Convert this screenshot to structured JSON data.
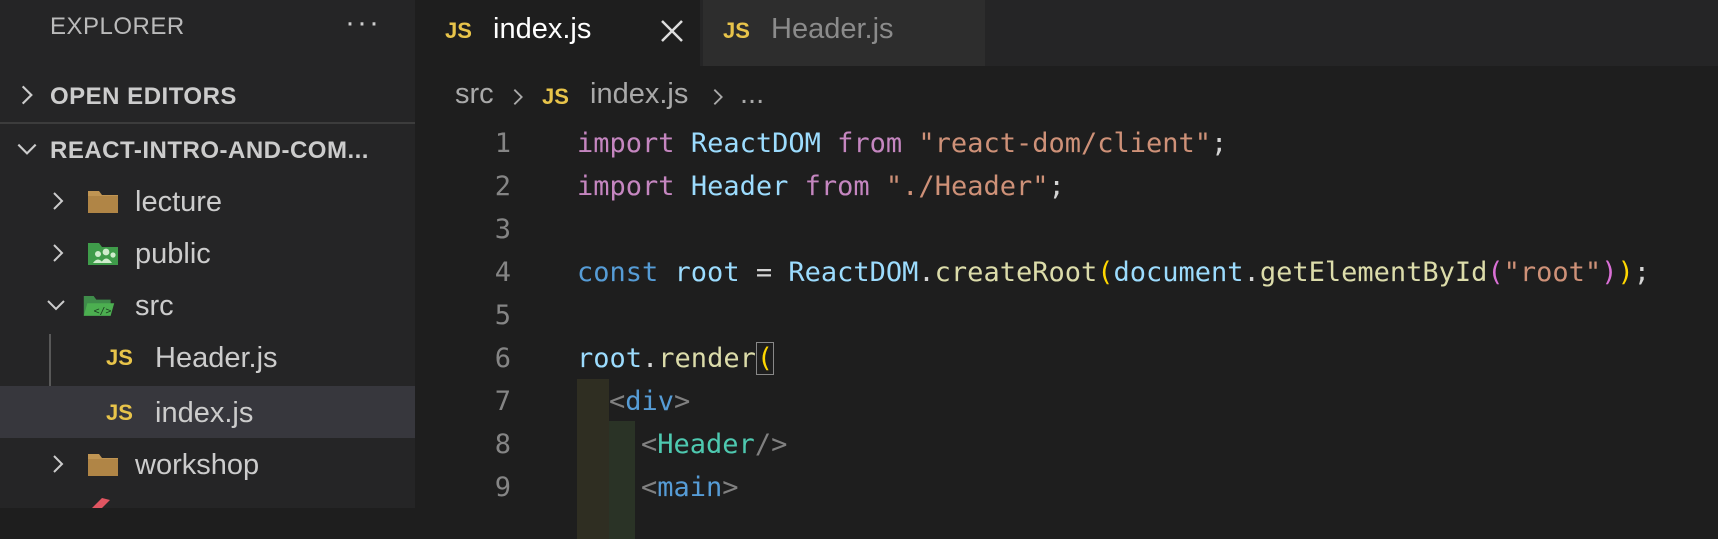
{
  "sidebar": {
    "title": "EXPLORER",
    "more_icon": "ellipsis-icon",
    "open_editors": "OPEN EDITORS",
    "project": "REACT-INTRO-AND-COM...",
    "items": [
      {
        "name": "lecture",
        "type": "folder"
      },
      {
        "name": "public",
        "type": "folder-public"
      },
      {
        "name": "src",
        "type": "folder-src"
      },
      {
        "name": "Header.js",
        "type": "js"
      },
      {
        "name": "index.js",
        "type": "js"
      },
      {
        "name": "workshop",
        "type": "folder"
      }
    ]
  },
  "tabs": [
    {
      "label": "index.js",
      "badge": "JS",
      "active": true
    },
    {
      "label": "Header.js",
      "badge": "JS",
      "active": false
    }
  ],
  "breadcrumb": {
    "folder": "src",
    "badge": "JS",
    "file": "index.js",
    "ellipsis": "..."
  },
  "editor": {
    "line_numbers": [
      "1",
      "2",
      "3",
      "4",
      "5",
      "6",
      "7",
      "8",
      "9"
    ],
    "l1": {
      "import": "import",
      "name": "ReactDOM",
      "from": "from",
      "path": "\"react-dom/client\"",
      "semi": ";"
    },
    "l2": {
      "import": "import",
      "name": "Header",
      "from": "from",
      "path": "\"./Header\"",
      "semi": ";"
    },
    "l4": {
      "const": "const",
      "root": "root",
      "eq": " = ",
      "obj": "ReactDOM",
      "dot": ".",
      "fn": "createRoot",
      "open": "(",
      "doc": "document",
      "dot2": ".",
      "fn2": "getElementById",
      "open2": "(",
      "arg": "\"root\"",
      "close2": ")",
      "close": ")",
      "semi": ";"
    },
    "l6": {
      "root": "root",
      "dot": ".",
      "fn": "render",
      "open": "("
    },
    "l7": {
      "lt": "<",
      "tag": "div",
      "gt": ">"
    },
    "l8": {
      "lt": "<",
      "comp": "Header",
      "end": "/>"
    },
    "l9": {
      "lt": "<",
      "tag": "main",
      "gt": ">"
    }
  },
  "colors": {
    "accent_js": "#e8c44a",
    "background": "#1e1e1e",
    "sidebar": "#252526"
  }
}
